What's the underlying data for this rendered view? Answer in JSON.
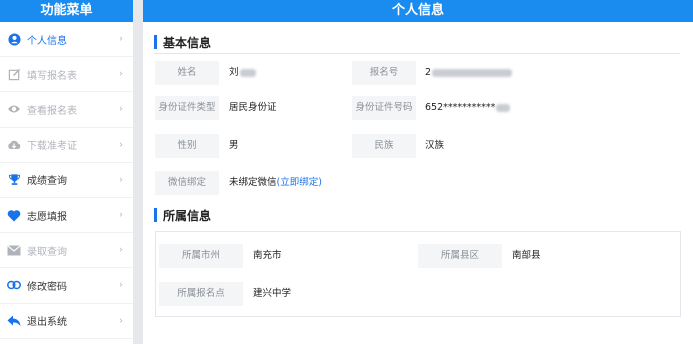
{
  "sidebar": {
    "title": "功能菜单",
    "items": [
      {
        "label": "个人信息",
        "icon": "user-icon"
      },
      {
        "label": "填写报名表",
        "icon": "edit-icon"
      },
      {
        "label": "查看报名表",
        "icon": "eye-icon"
      },
      {
        "label": "下载准考证",
        "icon": "cloud-download-icon"
      },
      {
        "label": "成绩查询",
        "icon": "trophy-icon"
      },
      {
        "label": "志愿填报",
        "icon": "heart-icon"
      },
      {
        "label": "录取查询",
        "icon": "mail-icon"
      },
      {
        "label": "修改密码",
        "icon": "link-icon"
      },
      {
        "label": "退出系统",
        "icon": "reply-arrow-icon"
      }
    ],
    "chevron": "›"
  },
  "main": {
    "title": "个人信息",
    "basic": {
      "title": "基本信息",
      "name_label": "姓名",
      "name_value": "刘",
      "regno_label": "报名号",
      "regno_value": "2",
      "idtype_label": "身份证件类型",
      "idtype_value": "居民身份证",
      "idno_label": "身份证件号码",
      "idno_value": "652***********",
      "gender_label": "性别",
      "gender_value": "男",
      "ethnic_label": "民族",
      "ethnic_value": "汉族",
      "wechat_label": "微信绑定",
      "wechat_value": "未绑定微信",
      "wechat_link": "(立即绑定)"
    },
    "affil": {
      "title": "所属信息",
      "city_label": "所属市州",
      "city_value": "南充市",
      "county_label": "所属县区",
      "county_value": "南部县",
      "site_label": "所属报名点",
      "site_value": "建兴中学"
    }
  },
  "colors": {
    "accent": "#1a8cf0",
    "link": "#1a73e8"
  }
}
